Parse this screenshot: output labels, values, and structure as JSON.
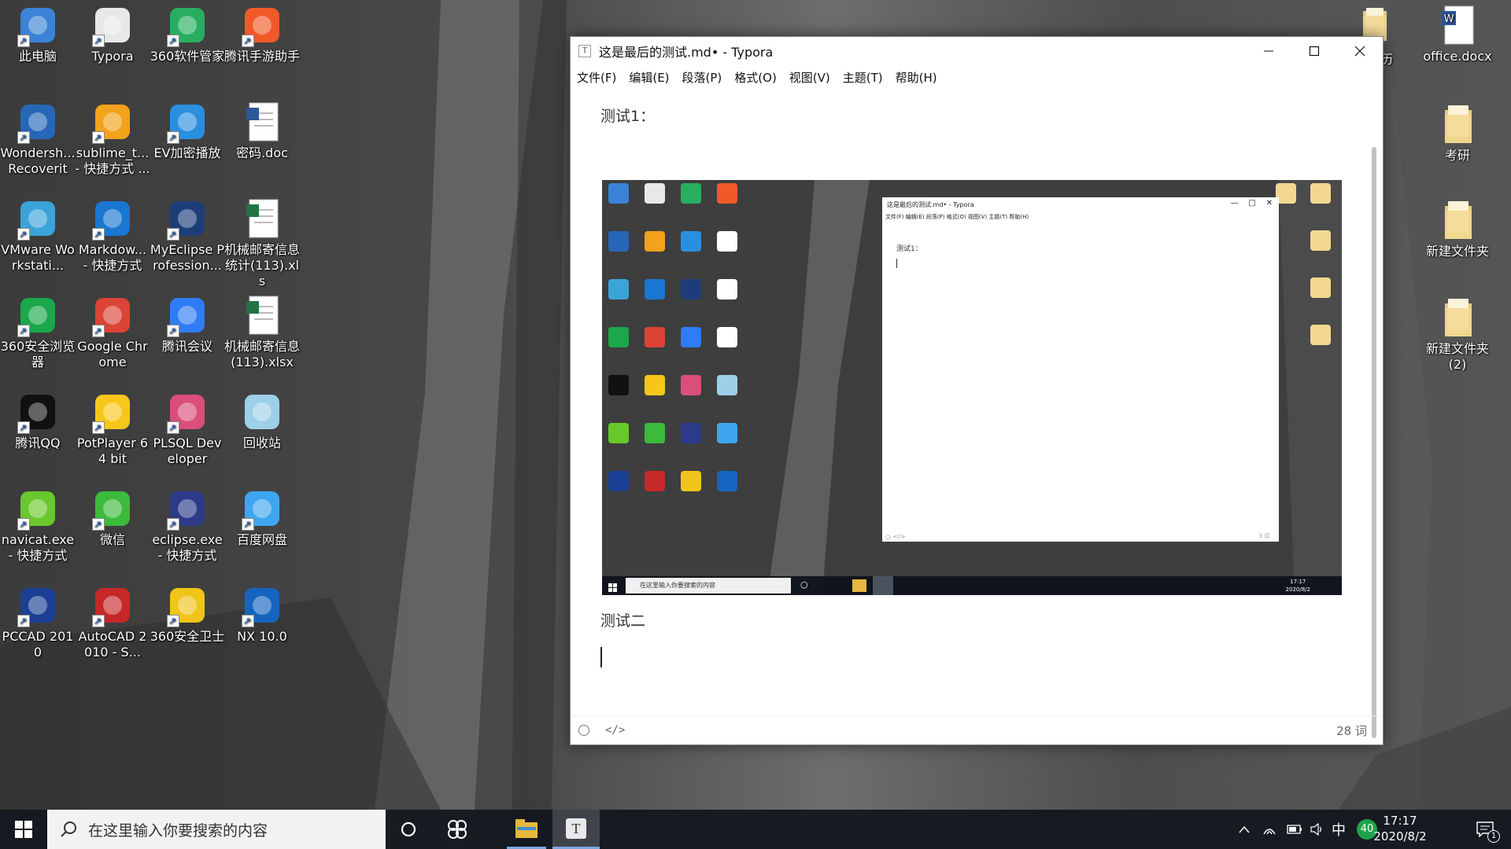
{
  "desktop": {
    "left_icons": [
      {
        "label": "此电脑"
      },
      {
        "label": "Typora"
      },
      {
        "label": "360软件管家"
      },
      {
        "label": "腾讯手游助手"
      },
      {
        "label": "Wondersh... Recoverit"
      },
      {
        "label": "sublime_t... - 快捷方式 ..."
      },
      {
        "label": "EV加密播放"
      },
      {
        "label": "密码.doc"
      },
      {
        "label": "VMware Workstati..."
      },
      {
        "label": "Markdow... - 快捷方式"
      },
      {
        "label": "MyEclipse Profession..."
      },
      {
        "label": "机械邮寄信息统计(113).xls"
      },
      {
        "label": "360安全浏览器"
      },
      {
        "label": "Google Chrome"
      },
      {
        "label": "腾讯会议"
      },
      {
        "label": "机械邮寄信息(113).xlsx"
      },
      {
        "label": "腾讯QQ"
      },
      {
        "label": "PotPlayer 64 bit"
      },
      {
        "label": "PLSQL Developer"
      },
      {
        "label": "回收站"
      },
      {
        "label": "navicat.exe - 快捷方式"
      },
      {
        "label": "微信"
      },
      {
        "label": "eclipse.exe - 快捷方式"
      },
      {
        "label": "百度网盘"
      },
      {
        "label": "PCCAD 2010"
      },
      {
        "label": "AutoCAD 2010 - S..."
      },
      {
        "label": "360安全卫士"
      },
      {
        "label": "NX 10.0"
      }
    ],
    "right_icons": [
      {
        "label": "历"
      },
      {
        "label": "office.docx"
      },
      {
        "label": "考研"
      },
      {
        "label": "新建文件夹"
      },
      {
        "label": "新建文件夹 (2)"
      }
    ]
  },
  "window": {
    "app_icon": "T",
    "title": "这是最后的测试.md• - Typora",
    "menu": [
      "文件(F)",
      "编辑(E)",
      "段落(P)",
      "格式(O)",
      "视图(V)",
      "主题(T)",
      "帮助(H)"
    ],
    "heading1": "测试1：",
    "heading2": "测试二",
    "word_count": "28 词",
    "mini": {
      "title": "这是最后的测试.md• - Typora",
      "menu": "文件(F)   编辑(E)   段落(P)   格式(O)   视图(V)   主题(T)   帮助(H)",
      "heading": "测试1：",
      "search": "在这里输入你要搜索的内容",
      "time": "17:17",
      "date": "2020/8/2",
      "word_count": "3 词"
    }
  },
  "taskbar": {
    "search_placeholder": "在这里输入你要搜索的内容",
    "ime": "中",
    "badge": "40",
    "time": "17:17",
    "date": "2020/8/2",
    "notif_count": "1"
  }
}
